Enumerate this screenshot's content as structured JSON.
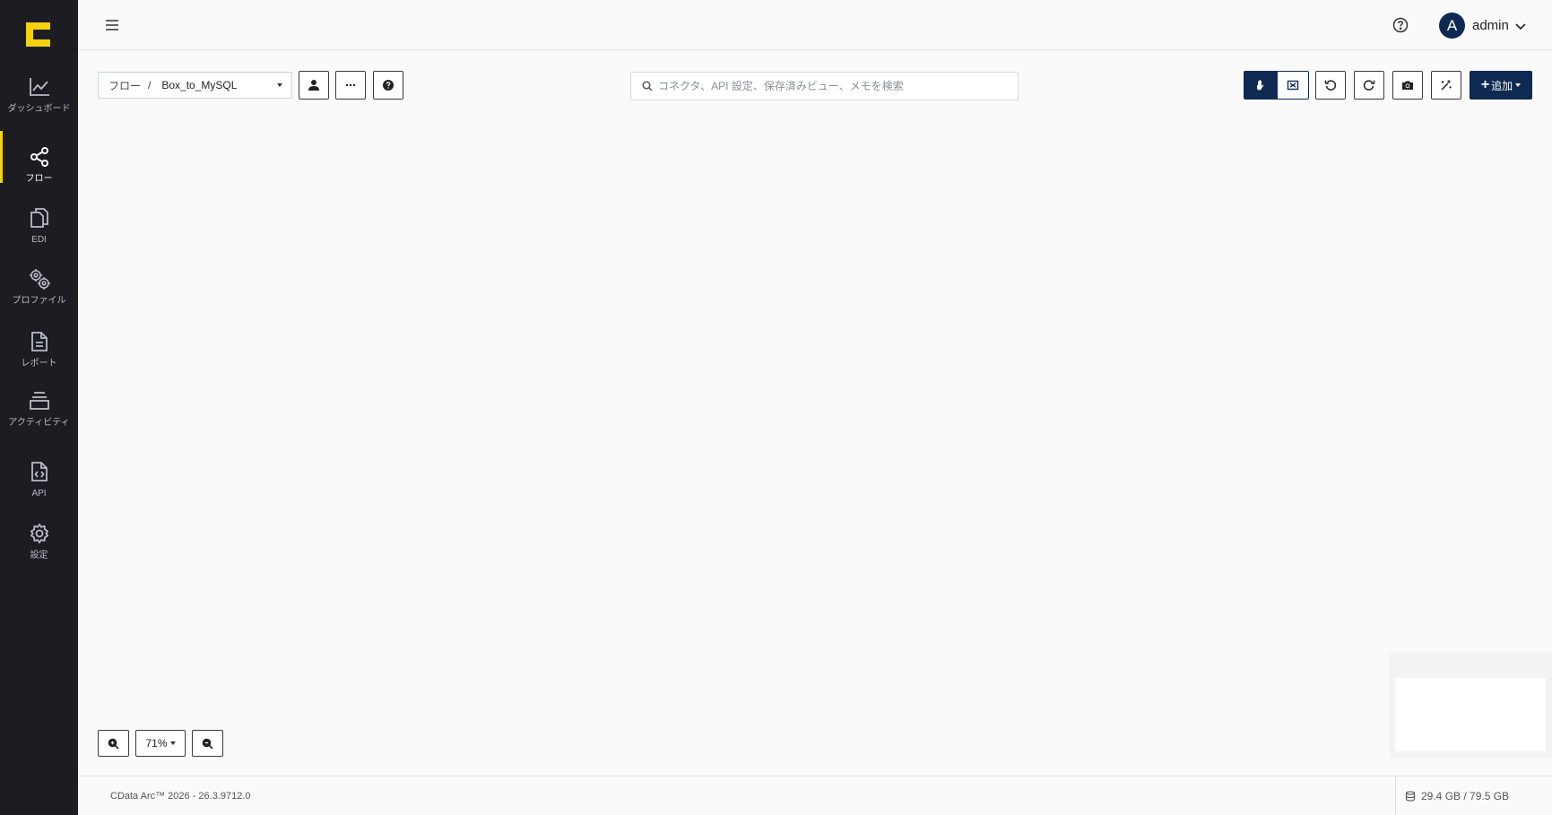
{
  "sidebar": {
    "items": [
      {
        "label": "ダッシュボード",
        "icon": "chart-line-icon"
      },
      {
        "label": "フロー",
        "icon": "share-nodes-icon"
      },
      {
        "label": "EDI",
        "icon": "documents-icon"
      },
      {
        "label": "プロファイル",
        "icon": "gears-icon"
      },
      {
        "label": "レポート",
        "icon": "file-text-icon"
      },
      {
        "label": "アクティビティ",
        "icon": "layers-icon"
      },
      {
        "label": "API",
        "icon": "file-code-icon"
      },
      {
        "label": "設定",
        "icon": "gear-icon"
      }
    ],
    "active_index": 1,
    "accent_color": "#f5d10f"
  },
  "header": {
    "user_initial": "A",
    "user_name": "admin"
  },
  "toolbar": {
    "breadcrumb_root": "フロー",
    "breadcrumb_sep": "/",
    "flow_name": "Box_to_MySQL",
    "search_placeholder": "コネクタ、API 設定、保存済みビュー、メモを検索",
    "add_label": "追加"
  },
  "canvas": {
    "zoom_label": "71%"
  },
  "footer": {
    "version": "CData Arc™ 2026 - 26.3.9712.0",
    "storage": "29.4 GB / 79.5 GB"
  },
  "colors": {
    "primary": "#0f2a52",
    "sidebar_bg": "#1b1d22"
  }
}
